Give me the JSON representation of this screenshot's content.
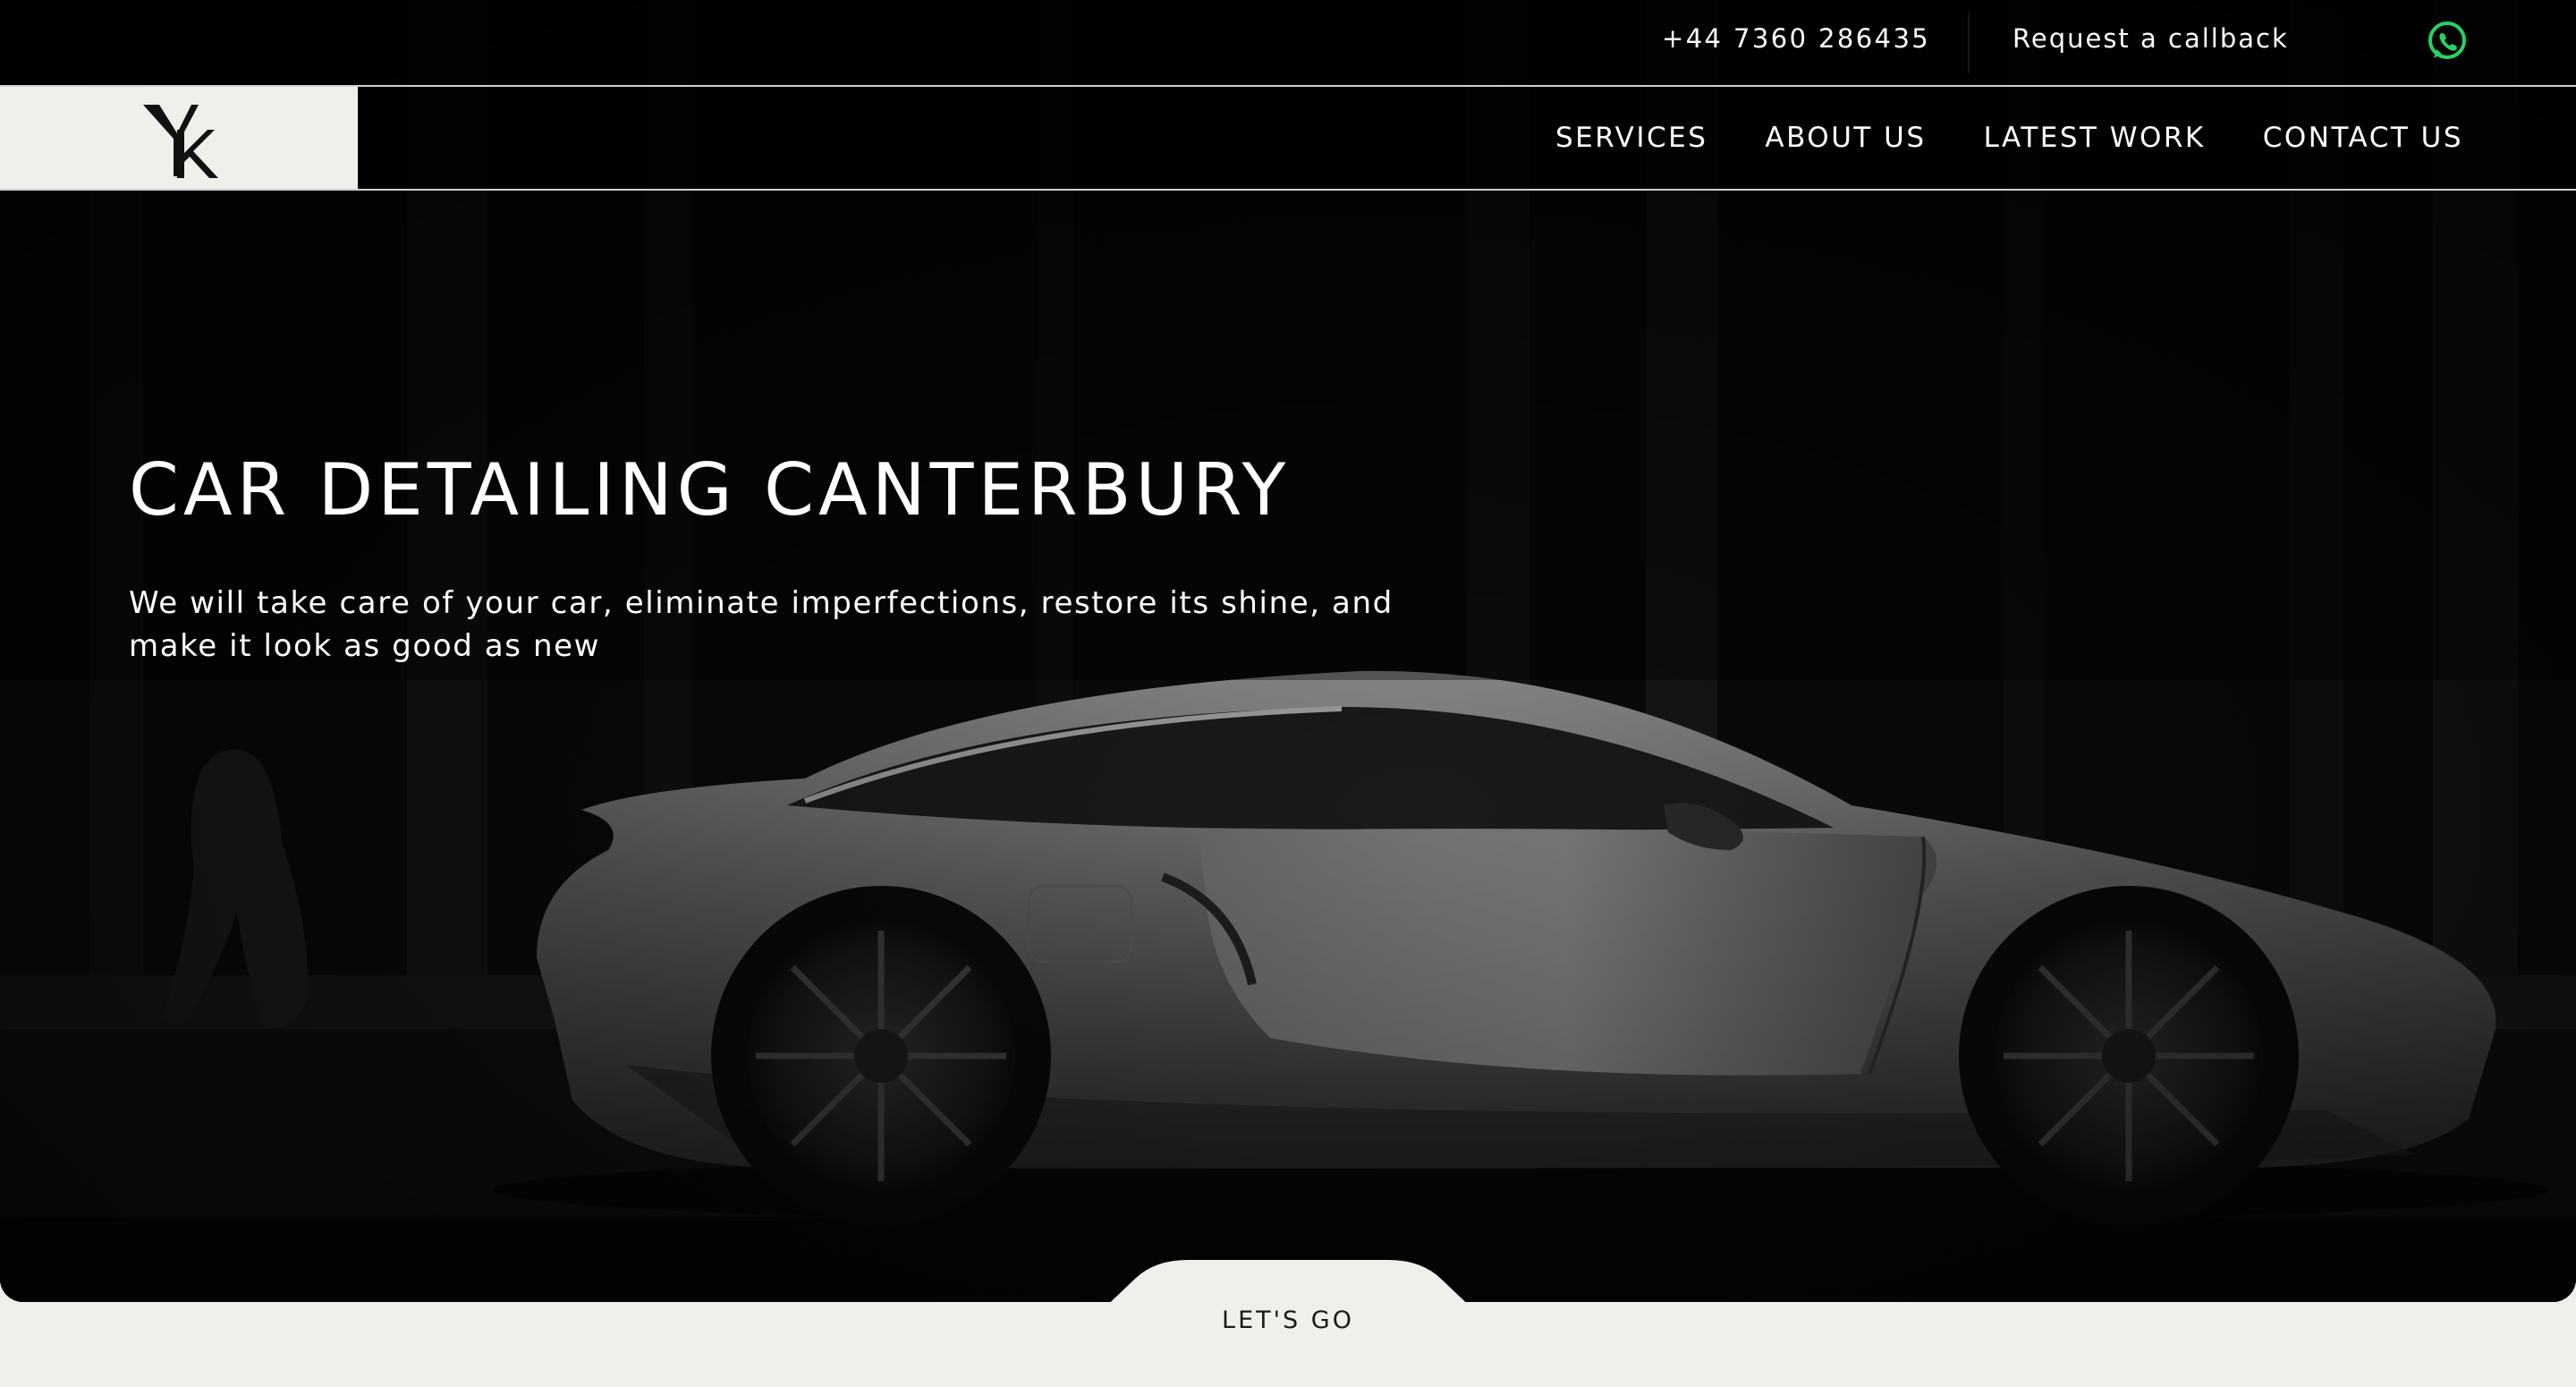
{
  "topbar": {
    "phone": "+44 7360 286435",
    "callback_label": "Request a callback",
    "whatsapp_icon": "whatsapp-icon",
    "whatsapp_color": "#25d366"
  },
  "logo": {
    "letters": "YK",
    "background": "#f0efea"
  },
  "nav": {
    "items": [
      {
        "label": "SERVICES"
      },
      {
        "label": "ABOUT US"
      },
      {
        "label": "LATEST WORK"
      },
      {
        "label": "CONTACT US"
      }
    ]
  },
  "hero": {
    "title": "CAR DETAILING CANTERBURY",
    "subtitle": "We will take care of your car, eliminate imperfections, restore its shine, and make it look as good as new"
  },
  "cta": {
    "label": "LET'S GO"
  },
  "colors": {
    "hero_background": "#060606",
    "page_background": "#f0efea",
    "text_light": "#ffffff",
    "text_dark": "#1a1a1a"
  }
}
